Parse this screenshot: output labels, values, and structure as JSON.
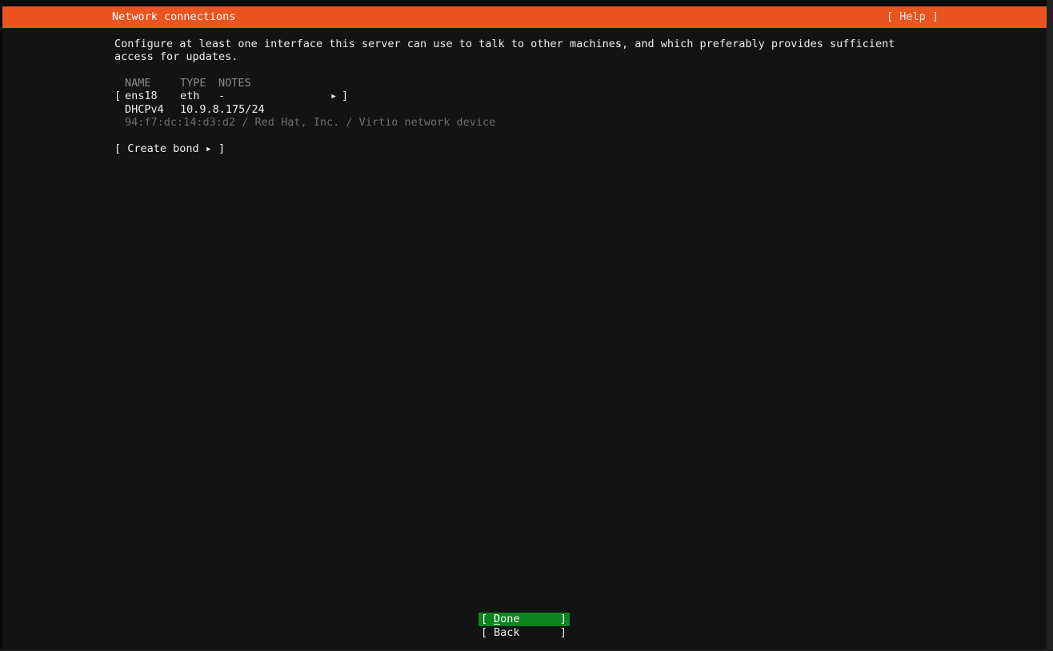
{
  "header": {
    "title": "Network connections",
    "help_label": "[ Help ]"
  },
  "description": {
    "line1": "Configure at least one interface this server can use to talk to other machines, and which preferably provides sufficient",
    "line2": "access for updates."
  },
  "interfaces_table": {
    "columns": {
      "name": "NAME",
      "type": "TYPE",
      "notes": "NOTES"
    },
    "row": {
      "open_bracket": "[",
      "name": "ens18",
      "type": "eth",
      "notes": "-",
      "expand_arrow": "▸",
      "close_bracket": "]"
    },
    "dhcp": {
      "label": "DHCPv4",
      "address": "10.9.8.175/24"
    },
    "device_info": "94:f7:dc:14:d3:d2 / Red Hat, Inc. / Virtio network device"
  },
  "create_bond": {
    "label": "[ Create bond ▸ ]"
  },
  "footer": {
    "done": {
      "open": "[",
      "key": "D",
      "rest": "one",
      "close": "]"
    },
    "back": {
      "open": "[",
      "label": "Back",
      "close": "]"
    }
  },
  "colors": {
    "header_bg": "#E95420",
    "done_bg": "#0E8420",
    "screen_bg": "#131313",
    "text": "#EDEDED",
    "muted": "#8A8A8A",
    "device_muted": "#6E6E6E"
  }
}
